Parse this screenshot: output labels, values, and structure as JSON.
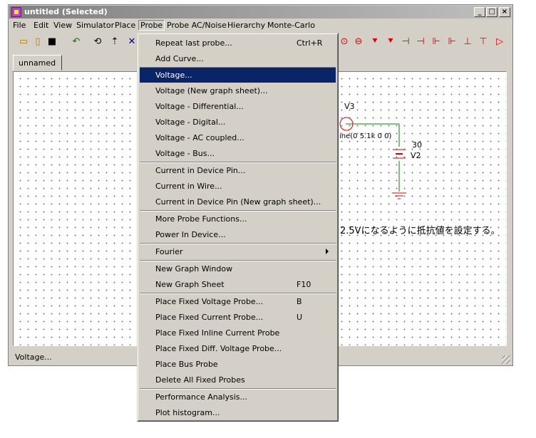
{
  "window": {
    "title": "untitled (Selected)",
    "min_symbol": "_",
    "max_symbol": "□",
    "close_symbol": "×"
  },
  "menubar": [
    "File",
    "Edit",
    "View",
    "Simulator",
    "Place",
    "Probe",
    "Probe AC/Noise",
    "Hierarchy",
    "Monte-Carlo"
  ],
  "active_menu": "Probe",
  "toolbar_icons": [
    "open-folder-icon",
    "new-file-icon",
    "save-icon",
    "undo-icon",
    "zoom-fit-icon",
    "zoom-icon",
    "select-icon",
    "current-source-icon",
    "voltage-source-icon",
    "diode-icon",
    "zener-diode-icon",
    "capacitor-vertical-icon",
    "capacitor-split-icon",
    "jfet-icon",
    "jfet-p-icon",
    "mosfet-icon",
    "mosfet-p-icon",
    "opamp-icon"
  ],
  "tabs": [
    "unnamed"
  ],
  "schematic": {
    "source_v3_label": "V3",
    "source_v3_value": "ine(0 5.1k 0 0)",
    "source_v2_value": "30",
    "source_v2_label": "V2",
    "note": "2.5Vになるように抵抗値を設定する。",
    "wire_color": "#008000",
    "source_color": "#e00000",
    "ground_color": "#e00000"
  },
  "status_text": "Voltage...",
  "menu": {
    "groups": [
      [
        {
          "label": "Repeat last probe...",
          "shortcut": "Ctrl+R"
        },
        {
          "label": "Add Curve..."
        }
      ],
      [
        {
          "label": "Voltage...",
          "highlighted": true
        },
        {
          "label": "Voltage (New graph sheet)..."
        },
        {
          "label": "Voltage - Differential..."
        },
        {
          "label": "Voltage - Digital..."
        },
        {
          "label": "Voltage - AC coupled..."
        },
        {
          "label": "Voltage - Bus..."
        }
      ],
      [
        {
          "label": "Current in Device Pin..."
        },
        {
          "label": "Current in Wire..."
        },
        {
          "label": "Current in Device Pin (New graph sheet)..."
        }
      ],
      [
        {
          "label": "More Probe Functions..."
        },
        {
          "label": "Power In Device..."
        }
      ],
      [
        {
          "label": "Fourier",
          "submenu": true
        }
      ],
      [
        {
          "label": "New Graph Window"
        },
        {
          "label": "New Graph Sheet",
          "shortcut": "F10"
        }
      ],
      [
        {
          "label": "Place Fixed Voltage Probe...",
          "shortcut": "B"
        },
        {
          "label": "Place Fixed Current Probe...",
          "shortcut": "U"
        },
        {
          "label": "Place Fixed Inline Current Probe"
        },
        {
          "label": "Place Fixed Diff. Voltage Probe..."
        },
        {
          "label": "Place Bus Probe"
        },
        {
          "label": "Delete All Fixed Probes"
        }
      ],
      [
        {
          "label": "Performance Analysis..."
        },
        {
          "label": "Plot histogram..."
        }
      ]
    ]
  }
}
